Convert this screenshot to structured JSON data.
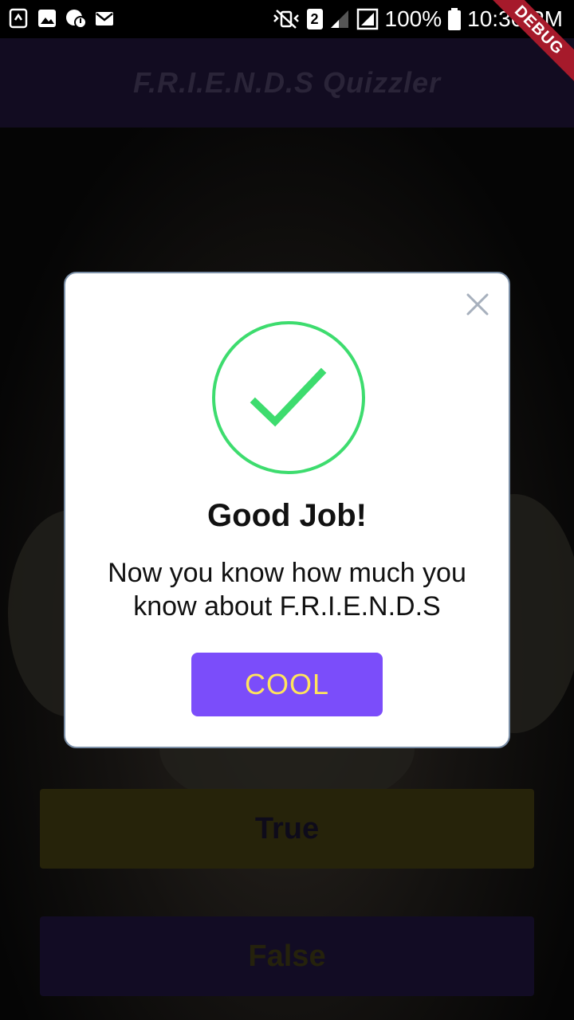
{
  "status_bar": {
    "left_icons": [
      "sync-alert-icon",
      "image-icon",
      "chat-alert-icon",
      "mail-icon"
    ],
    "right_icons": [
      "vibrate-off-icon",
      "sim-2-icon",
      "signal-icon",
      "data-signal-icon",
      "battery-icon"
    ],
    "sim_label": "2",
    "battery": "100%",
    "time": "10:36 PM"
  },
  "app_bar": {
    "title": "F.R.I.E.N.D.S  Quizzler"
  },
  "debug_banner": {
    "label": "DEBUG"
  },
  "answers": {
    "true_label": "True",
    "false_label": "False"
  },
  "dialog": {
    "title": "Good Job!",
    "message": "Now you know how much you know about F.R.I.E.N.D.S",
    "button_label": "COOL",
    "close_icon": "close-icon",
    "success_icon": "check-circle-icon",
    "success_color": "#3ddc6e",
    "button_color": "#7b4dfa",
    "button_text_color": "#ffe45c"
  }
}
